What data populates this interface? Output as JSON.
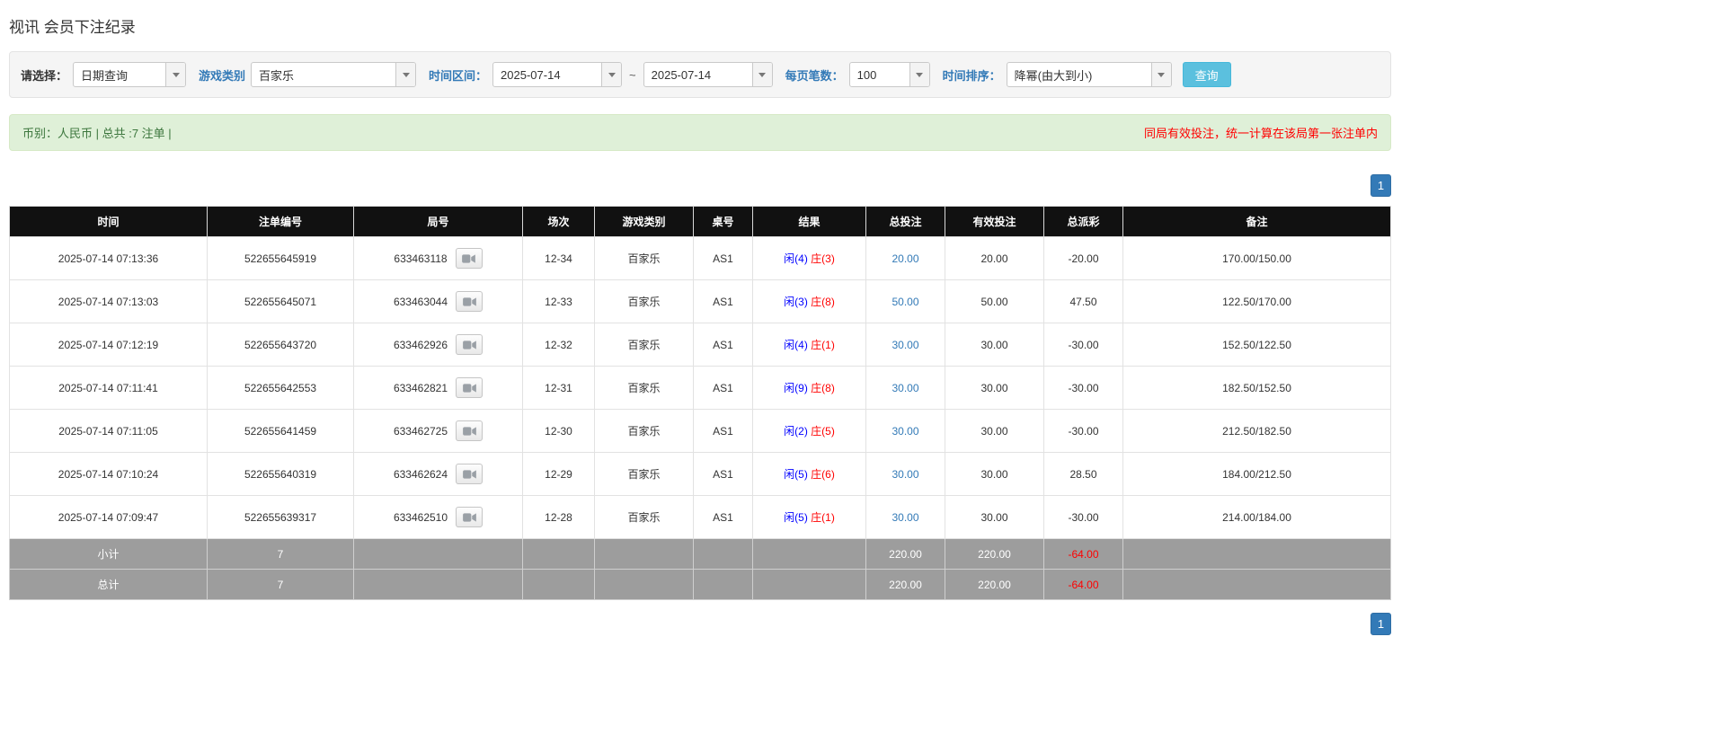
{
  "page": {
    "title": "视讯 会员下注纪录"
  },
  "filters": {
    "select_label": "请选择：",
    "select_value": "日期查询",
    "game_label": "游戏类别",
    "game_value": "百家乐",
    "range_label": "时间区间：",
    "date_from": "2025-07-14",
    "tilde": "~",
    "date_to": "2025-07-14",
    "per_page_label": "每页笔数：",
    "per_page_value": "100",
    "sort_label": "时间排序：",
    "sort_value": "降幂(由大到小)",
    "query_button": "查询"
  },
  "notice": {
    "left": "币别：人民币 | 总共 :7 注单 |",
    "right": "同局有效投注，统一计算在该局第一张注单内"
  },
  "pagination": {
    "page": "1"
  },
  "icons": {
    "replay": "video-icon",
    "dropdown": "chevron-down-icon"
  },
  "colors": {
    "header_bg": "#111111",
    "footer_bg": "#9d9d9d",
    "notice_bg": "#dff0d8",
    "notice_text": "#3c763d",
    "warning_red": "#ff0000",
    "link_blue": "#337ab7",
    "result_player_blue": "#0000ff",
    "result_banker_red": "#ff0000",
    "query_button_bg": "#5bc0de",
    "pagination_bg": "#337ab7"
  },
  "table": {
    "headers": [
      "时间",
      "注单编号",
      "局号",
      "场次",
      "游戏类别",
      "桌号",
      "结果",
      "总投注",
      "有效投注",
      "总派彩",
      "备注"
    ],
    "rows": [
      {
        "time": "2025-07-14 07:13:36",
        "bet_no": "522655645919",
        "round_no": "633463118",
        "session": "12-34",
        "game": "百家乐",
        "table_no": "AS1",
        "result_player": "闲(4)",
        "result_banker": "庄(3)",
        "total_bet": "20.00",
        "valid_bet": "20.00",
        "payout": "-20.00",
        "payout_neg": true,
        "remark": "170.00/150.00"
      },
      {
        "time": "2025-07-14 07:13:03",
        "bet_no": "522655645071",
        "round_no": "633463044",
        "session": "12-33",
        "game": "百家乐",
        "table_no": "AS1",
        "result_player": "闲(3)",
        "result_banker": "庄(8)",
        "total_bet": "50.00",
        "valid_bet": "50.00",
        "payout": "47.50",
        "payout_neg": false,
        "remark": "122.50/170.00"
      },
      {
        "time": "2025-07-14 07:12:19",
        "bet_no": "522655643720",
        "round_no": "633462926",
        "session": "12-32",
        "game": "百家乐",
        "table_no": "AS1",
        "result_player": "闲(4)",
        "result_banker": "庄(1)",
        "total_bet": "30.00",
        "valid_bet": "30.00",
        "payout": "-30.00",
        "payout_neg": true,
        "remark": "152.50/122.50"
      },
      {
        "time": "2025-07-14 07:11:41",
        "bet_no": "522655642553",
        "round_no": "633462821",
        "session": "12-31",
        "game": "百家乐",
        "table_no": "AS1",
        "result_player": "闲(9)",
        "result_banker": "庄(8)",
        "total_bet": "30.00",
        "valid_bet": "30.00",
        "payout": "-30.00",
        "payout_neg": true,
        "remark": "182.50/152.50"
      },
      {
        "time": "2025-07-14 07:11:05",
        "bet_no": "522655641459",
        "round_no": "633462725",
        "session": "12-30",
        "game": "百家乐",
        "table_no": "AS1",
        "result_player": "闲(2)",
        "result_banker": "庄(5)",
        "total_bet": "30.00",
        "valid_bet": "30.00",
        "payout": "-30.00",
        "payout_neg": true,
        "remark": "212.50/182.50"
      },
      {
        "time": "2025-07-14 07:10:24",
        "bet_no": "522655640319",
        "round_no": "633462624",
        "session": "12-29",
        "game": "百家乐",
        "table_no": "AS1",
        "result_player": "闲(5)",
        "result_banker": "庄(6)",
        "total_bet": "30.00",
        "valid_bet": "30.00",
        "payout": "28.50",
        "payout_neg": false,
        "remark": "184.00/212.50"
      },
      {
        "time": "2025-07-14 07:09:47",
        "bet_no": "522655639317",
        "round_no": "633462510",
        "session": "12-28",
        "game": "百家乐",
        "table_no": "AS1",
        "result_player": "闲(5)",
        "result_banker": "庄(1)",
        "total_bet": "30.00",
        "valid_bet": "30.00",
        "payout": "-30.00",
        "payout_neg": true,
        "remark": "214.00/184.00"
      }
    ],
    "subtotal": {
      "label": "小计",
      "count": "7",
      "total_bet": "220.00",
      "valid_bet": "220.00",
      "payout": "-64.00"
    },
    "total": {
      "label": "总计",
      "count": "7",
      "total_bet": "220.00",
      "valid_bet": "220.00",
      "payout": "-64.00"
    }
  }
}
